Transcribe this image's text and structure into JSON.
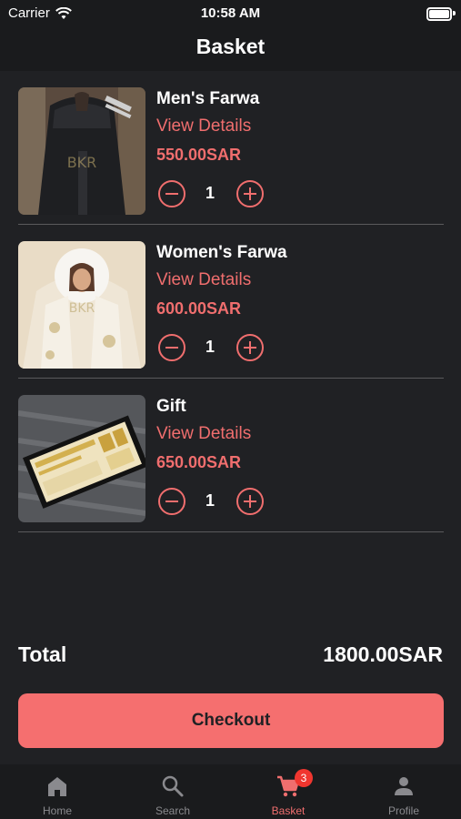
{
  "status_bar": {
    "carrier": "Carrier",
    "time": "10:58 AM"
  },
  "header": {
    "title": "Basket"
  },
  "items": [
    {
      "name": "Men's Farwa",
      "link_label": "View Details",
      "price": "550.00SAR",
      "quantity": "1"
    },
    {
      "name": "Women's Farwa",
      "link_label": "View Details",
      "price": "600.00SAR",
      "quantity": "1"
    },
    {
      "name": "Gift",
      "link_label": "View Details",
      "price": "650.00SAR",
      "quantity": "1"
    }
  ],
  "summary": {
    "total_label": "Total",
    "total_value": "1800.00SAR"
  },
  "checkout_label": "Checkout",
  "tabs": [
    {
      "label": "Home",
      "icon": "home-icon"
    },
    {
      "label": "Search",
      "icon": "search-icon"
    },
    {
      "label": "Basket",
      "icon": "cart-icon",
      "badge": "3",
      "active": true
    },
    {
      "label": "Profile",
      "icon": "person-icon"
    }
  ],
  "colors": {
    "accent": "#f06e6e",
    "button": "#f56f6f",
    "background": "#202124",
    "badge": "#f0362f"
  }
}
